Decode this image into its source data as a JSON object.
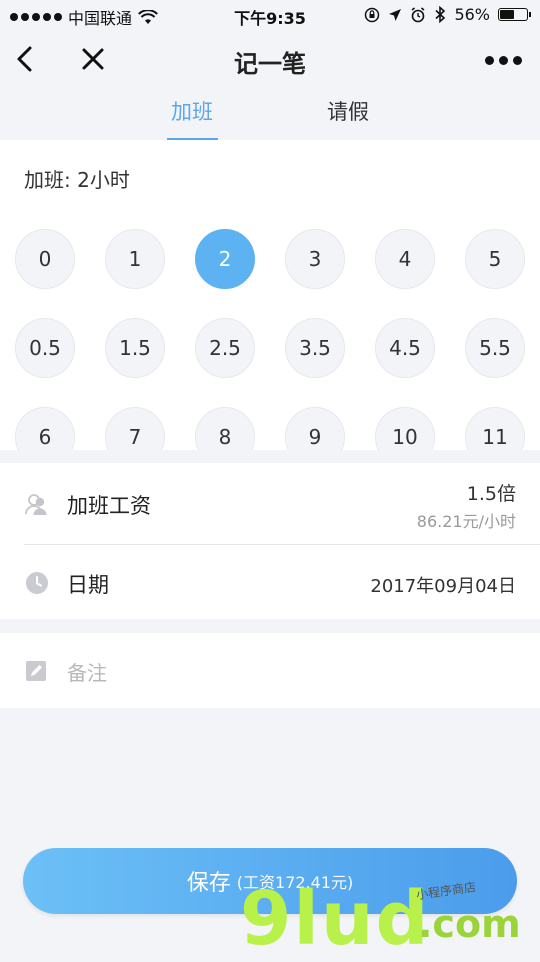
{
  "status_bar": {
    "carrier": "中国联通",
    "time": "下午9:35",
    "battery": "56%",
    "battery_level": 0.56
  },
  "nav": {
    "title": "记一笔"
  },
  "tabs": [
    {
      "label": "加班",
      "active": true
    },
    {
      "label": "请假",
      "active": false
    }
  ],
  "hours": {
    "label": "加班: 2小时",
    "options": [
      "0",
      "1",
      "2",
      "3",
      "4",
      "5",
      "0.5",
      "1.5",
      "2.5",
      "3.5",
      "4.5",
      "5.5",
      "6",
      "7",
      "8",
      "9",
      "10",
      "11"
    ],
    "selected": "2"
  },
  "wage": {
    "label": "加班工资",
    "multiplier": "1.5倍",
    "rate": "86.21元/小时"
  },
  "date": {
    "label": "日期",
    "value": "2017年09月04日"
  },
  "note": {
    "placeholder": "备注"
  },
  "save": {
    "label": "保存",
    "detail": "(工资172.41元)"
  },
  "watermark": {
    "brand": "9lud",
    "domain": ".com",
    "tagline": "小程序商店"
  },
  "colors": {
    "accent": "#5aa6ef",
    "selected_circle": "#5db2f1",
    "background": "#f3f4f8"
  }
}
